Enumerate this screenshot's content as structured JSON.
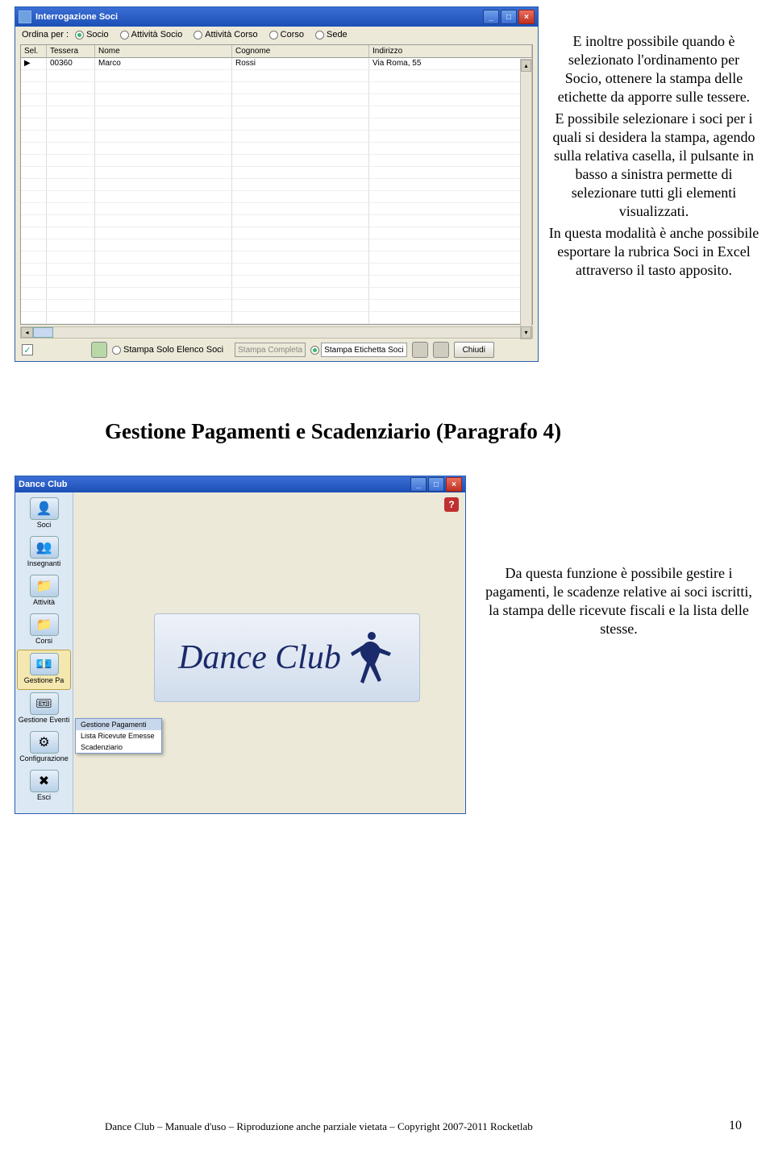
{
  "win1": {
    "title": "Interrogazione Soci",
    "order_label": "Ordina per :",
    "radios": [
      "Socio",
      "Attività Socio",
      "Attività Corso",
      "Corso",
      "Sede"
    ],
    "radio_selected": 0,
    "columns": [
      "Sel.",
      "Tessera",
      "Nome",
      "Cognome",
      "Indirizzo"
    ],
    "row": {
      "sel": "",
      "tessera": "00360",
      "nome": "Marco",
      "cognome": "Rossi",
      "indirizzo": "Via Roma, 55"
    },
    "stampa_solo": "Stampa Solo Elenco Soci",
    "stampa_completa": "Stampa Completa",
    "stampa_etichetta": "Stampa Etichetta Soci",
    "chiudi": "Chiudi"
  },
  "para_r": [
    "E inoltre possibile quando è selezionato l'ordinamento per Socio, ottenere la stampa delle etichette da apporre sulle tessere.",
    "E possibile selezionare i soci per i quali si desidera la stampa, agendo sulla relativa casella, il pulsante in basso a sinistra permette di selezionare tutti gli elementi visualizzati.",
    "In questa modalità è anche possibile esportare la rubrica Soci in Excel attraverso il tasto apposito."
  ],
  "heading": "Gestione Pagamenti e Scadenziario (Paragrafo 4)",
  "win2": {
    "title": "Dance Club",
    "sidebar": [
      {
        "label": "Soci",
        "glyph": "👤"
      },
      {
        "label": "Insegnanti",
        "glyph": "👥"
      },
      {
        "label": "Attività",
        "glyph": "📁"
      },
      {
        "label": "Corsi",
        "glyph": "📁"
      },
      {
        "label": "Gestione Pa",
        "glyph": "💶"
      },
      {
        "label": "Gestione Eventi",
        "glyph": "🎟"
      },
      {
        "label": "Configurazione",
        "glyph": "⚙"
      },
      {
        "label": "Esci",
        "glyph": "✖"
      }
    ],
    "popup": [
      "Gestione Pagamenti",
      "Lista Ricevute Emesse",
      "Scadenziario"
    ],
    "logo_text": "Dance Club"
  },
  "para2": "Da questa funzione è possibile gestire i pagamenti, le scadenze relative ai soci iscritti, la stampa delle ricevute fiscali e la lista delle stesse.",
  "footer": "Dance Club – Manuale d'uso – Riproduzione anche parziale vietata – Copyright 2007-2011 Rocketlab",
  "pagenum": "10"
}
